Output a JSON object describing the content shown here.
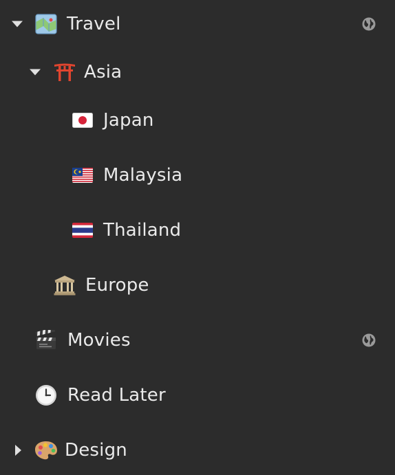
{
  "tree": {
    "travel": {
      "label": "Travel",
      "icon": "map-icon",
      "expanded": true,
      "shared": true
    },
    "asia": {
      "label": "Asia",
      "icon": "torii-gate-icon",
      "expanded": true
    },
    "japan": {
      "label": "Japan",
      "icon": "flag-japan-icon"
    },
    "malaysia": {
      "label": "Malaysia",
      "icon": "flag-malaysia-icon"
    },
    "thailand": {
      "label": "Thailand",
      "icon": "flag-thailand-icon"
    },
    "europe": {
      "label": "Europe",
      "icon": "classical-building-icon"
    },
    "movies": {
      "label": "Movies",
      "icon": "clapper-board-icon",
      "shared": true
    },
    "read_later": {
      "label": "Read Later",
      "icon": "clock-icon"
    },
    "design": {
      "label": "Design",
      "icon": "artist-palette-icon",
      "expanded": false
    }
  },
  "colors": {
    "background": "#2c2c2c",
    "text": "#eaeaea",
    "chevron": "#e0e0e0",
    "globe": "#9a9a9a"
  }
}
